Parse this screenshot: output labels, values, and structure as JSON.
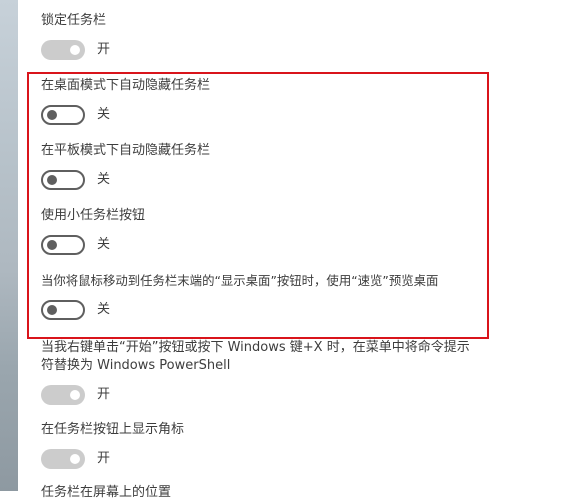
{
  "settings": [
    {
      "label": "锁定任务栏",
      "state": "开",
      "on": true
    },
    {
      "label": "在桌面模式下自动隐藏任务栏",
      "state": "关",
      "on": false
    },
    {
      "label": "在平板模式下自动隐藏任务栏",
      "state": "关",
      "on": false
    },
    {
      "label": "使用小任务栏按钮",
      "state": "关",
      "on": false
    },
    {
      "label": "当你将鼠标移动到任务栏末端的“显示桌面”按钮时，使用“速览”预览桌面",
      "state": "关",
      "on": false
    },
    {
      "label": "当我右键单击“开始”按钮或按下 Windows 键+X 时，在菜单中将命令提示符替换为 Windows PowerShell",
      "state": "开",
      "on": true
    },
    {
      "label": "在任务栏按钮上显示角标",
      "state": "开",
      "on": true
    }
  ],
  "partial_next_label": "任务栏在屏幕上的位置",
  "colors": {
    "highlight_border": "#d9141b",
    "toggle_off": "#5f5f5f",
    "toggle_on_disabled": "#cccccc"
  }
}
